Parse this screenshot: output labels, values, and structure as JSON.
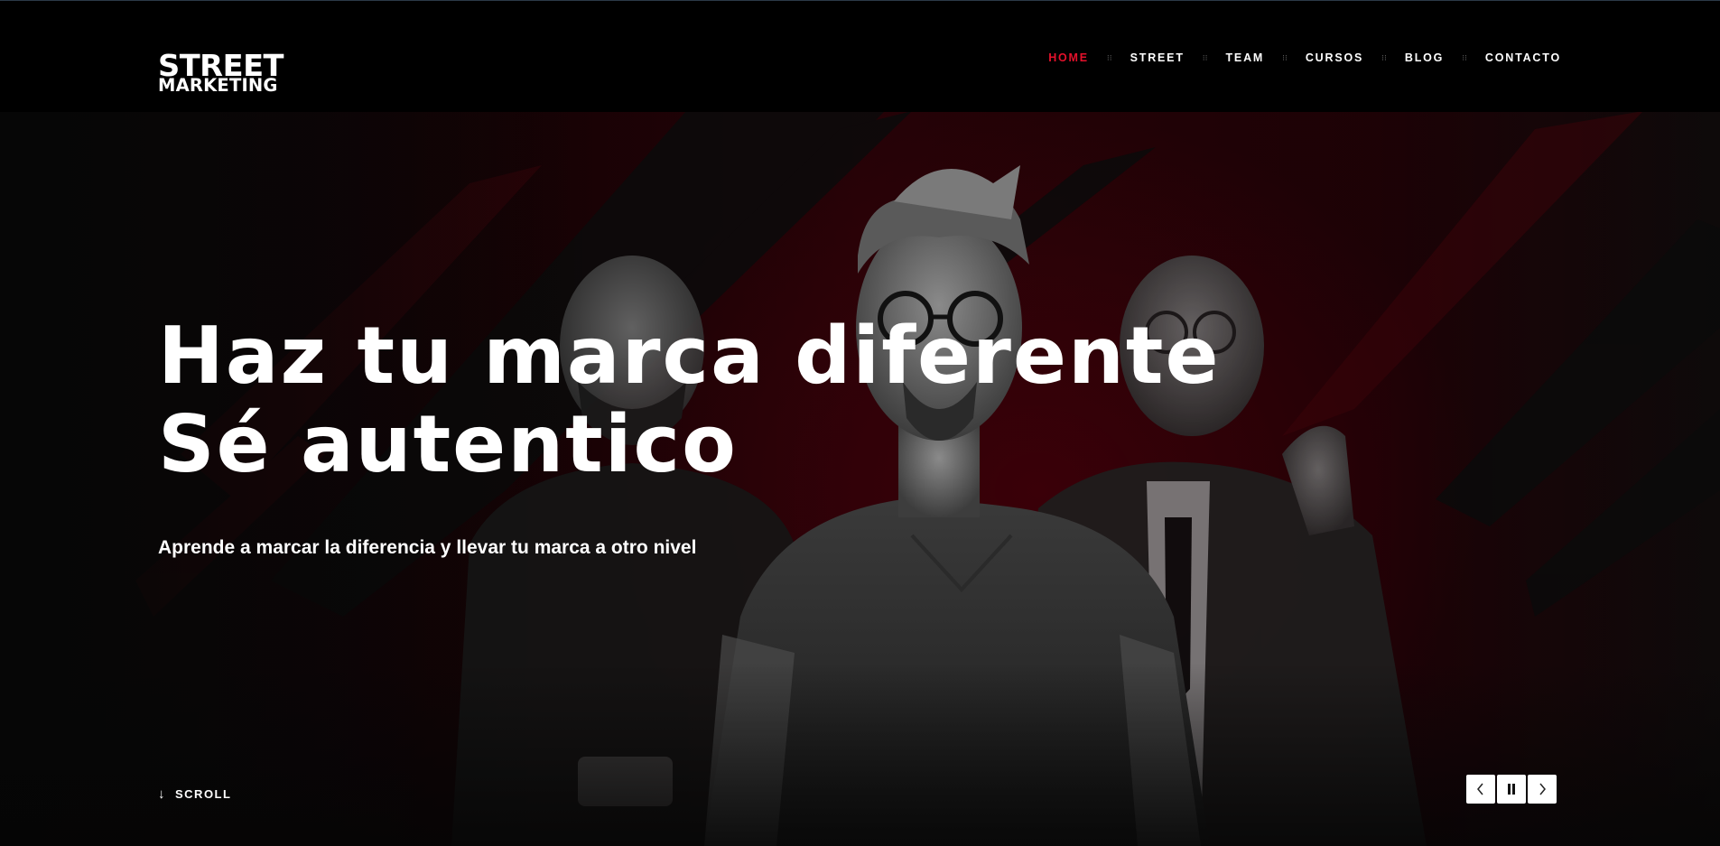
{
  "logo": {
    "line1": "STREET",
    "line2": "MARKETING"
  },
  "nav": {
    "items": [
      {
        "label": "HOME",
        "active": true
      },
      {
        "label": "STREET",
        "active": false
      },
      {
        "label": "TEAM",
        "active": false
      },
      {
        "label": "CURSOS",
        "active": false
      },
      {
        "label": "BLOG",
        "active": false
      },
      {
        "label": "CONTACTO",
        "active": false
      }
    ],
    "separator": "⁝⁝"
  },
  "hero": {
    "title_line1": "Haz tu marca diferente",
    "title_line2": "Sé autentico",
    "subtitle": "Aprende a marcar la diferencia y llevar tu marca a otro nivel",
    "scroll_label": "SCROLL"
  },
  "slider": {
    "prev_icon": "chevron-left-icon",
    "pause_icon": "pause-icon",
    "next_icon": "chevron-right-icon"
  },
  "colors": {
    "accent": "#e4112b",
    "header_bg": "#000000",
    "hero_red": "#2a0308",
    "text": "#ffffff"
  }
}
